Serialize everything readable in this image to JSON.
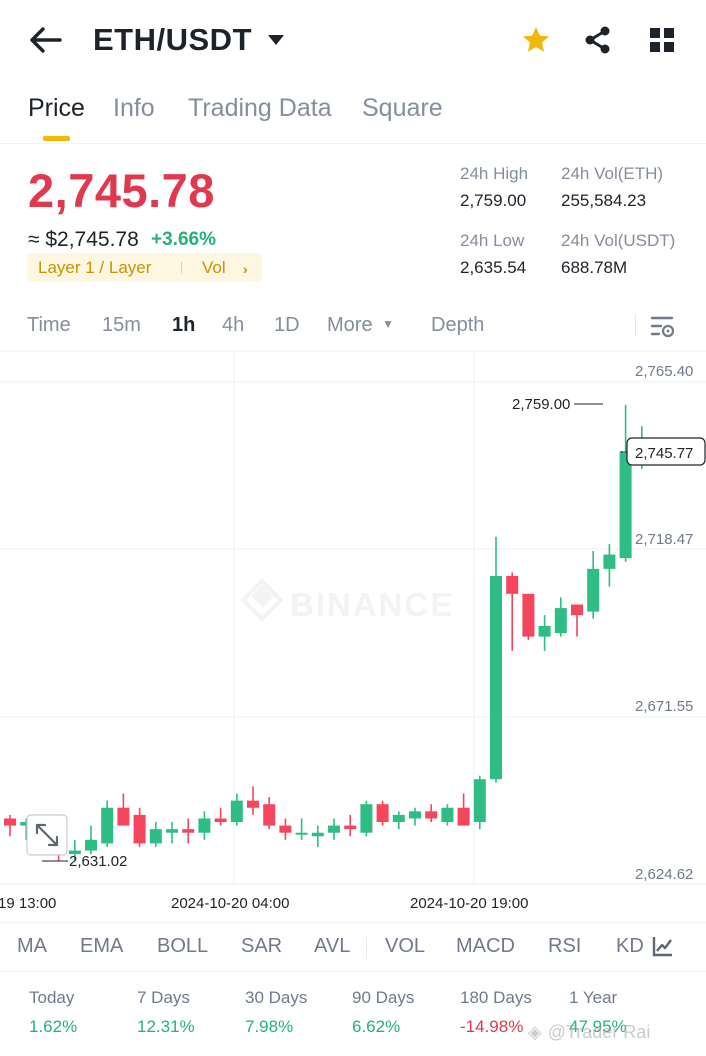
{
  "header": {
    "title": "ETH/USDT",
    "icons": [
      "back-arrow-icon",
      "dropdown-caret-icon",
      "star-icon",
      "share-icon",
      "grid-icon"
    ],
    "favorite_color": "#f0b90b"
  },
  "tabs": [
    "Price",
    "Info",
    "Trading Data",
    "Square"
  ],
  "price": {
    "last": "2,745.78",
    "usd": "≈ $2,745.78",
    "change": "+3.66%",
    "tag": "Layer 1 / Layer",
    "tag_vol": "Vol",
    "high_label": "24h High",
    "high": "2,759.00",
    "low_label": "24h Low",
    "low": "2,635.54",
    "vol_eth_label": "24h Vol(ETH)",
    "vol_eth": "255,584.23",
    "vol_usdt_label": "24h Vol(USDT)",
    "vol_usdt": "688.78M"
  },
  "intervals": [
    "Time",
    "15m",
    "1h",
    "4h",
    "1D",
    "More",
    "Depth"
  ],
  "chart_data": {
    "type": "candlestick",
    "interval": "1h",
    "y_ticks": [
      "2,765.40",
      "2,718.47",
      "2,671.55",
      "2,624.62"
    ],
    "ylim": [
      2624.62,
      2765.4
    ],
    "x_ticks": [
      "19 13:00",
      "2024-10-20 04:00",
      "2024-10-20 19:00"
    ],
    "max_label": "2,759.00",
    "min_label": "2,631.02",
    "last_label": "2,745.77",
    "watermark": "BINANCE",
    "up_color": "#2ebd85",
    "down_color": "#f6465d",
    "candles": [
      {
        "o": 2643,
        "h": 2644,
        "l": 2638,
        "c": 2641
      },
      {
        "o": 2641,
        "h": 2643,
        "l": 2637,
        "c": 2642
      },
      {
        "o": 2642,
        "h": 2642,
        "l": 2634,
        "c": 2636
      },
      {
        "o": 2636,
        "h": 2638,
        "l": 2631,
        "c": 2633
      },
      {
        "o": 2633,
        "h": 2637,
        "l": 2631,
        "c": 2634
      },
      {
        "o": 2634,
        "h": 2641,
        "l": 2633,
        "c": 2637
      },
      {
        "o": 2636,
        "h": 2648,
        "l": 2635,
        "c": 2646
      },
      {
        "o": 2646,
        "h": 2650,
        "l": 2641,
        "c": 2641
      },
      {
        "o": 2644,
        "h": 2646,
        "l": 2635,
        "c": 2636
      },
      {
        "o": 2636,
        "h": 2642,
        "l": 2635,
        "c": 2640
      },
      {
        "o": 2639,
        "h": 2642,
        "l": 2636,
        "c": 2640
      },
      {
        "o": 2640,
        "h": 2643,
        "l": 2636,
        "c": 2639
      },
      {
        "o": 2639,
        "h": 2645,
        "l": 2637,
        "c": 2643
      },
      {
        "o": 2643,
        "h": 2646,
        "l": 2641,
        "c": 2642
      },
      {
        "o": 2642,
        "h": 2650,
        "l": 2641,
        "c": 2648
      },
      {
        "o": 2648,
        "h": 2652,
        "l": 2644,
        "c": 2646
      },
      {
        "o": 2647,
        "h": 2649,
        "l": 2640,
        "c": 2641
      },
      {
        "o": 2641,
        "h": 2643,
        "l": 2637,
        "c": 2639
      },
      {
        "o": 2639,
        "h": 2643,
        "l": 2637,
        "c": 2639
      },
      {
        "o": 2638,
        "h": 2641,
        "l": 2635,
        "c": 2639
      },
      {
        "o": 2639,
        "h": 2643,
        "l": 2637,
        "c": 2641
      },
      {
        "o": 2641,
        "h": 2644,
        "l": 2638,
        "c": 2640
      },
      {
        "o": 2639,
        "h": 2648,
        "l": 2638,
        "c": 2647
      },
      {
        "o": 2647,
        "h": 2648,
        "l": 2641,
        "c": 2642
      },
      {
        "o": 2642,
        "h": 2645,
        "l": 2640,
        "c": 2644
      },
      {
        "o": 2643,
        "h": 2646,
        "l": 2641,
        "c": 2645
      },
      {
        "o": 2645,
        "h": 2647,
        "l": 2642,
        "c": 2643
      },
      {
        "o": 2642,
        "h": 2647,
        "l": 2641,
        "c": 2646
      },
      {
        "o": 2646,
        "h": 2650,
        "l": 2643,
        "c": 2641
      },
      {
        "o": 2642,
        "h": 2655,
        "l": 2640,
        "c": 2654
      },
      {
        "o": 2654,
        "h": 2722,
        "l": 2653,
        "c": 2711
      },
      {
        "o": 2711,
        "h": 2712,
        "l": 2690,
        "c": 2706
      },
      {
        "o": 2706,
        "h": 2706,
        "l": 2693,
        "c": 2694
      },
      {
        "o": 2694,
        "h": 2700,
        "l": 2690,
        "c": 2697
      },
      {
        "o": 2695,
        "h": 2705,
        "l": 2694,
        "c": 2702
      },
      {
        "o": 2703,
        "h": 2703,
        "l": 2694,
        "c": 2700
      },
      {
        "o": 2701,
        "h": 2718,
        "l": 2699,
        "c": 2713
      },
      {
        "o": 2713,
        "h": 2720,
        "l": 2708,
        "c": 2717
      },
      {
        "o": 2716,
        "h": 2759,
        "l": 2715,
        "c": 2746
      },
      {
        "o": 2745,
        "h": 2753,
        "l": 2741,
        "c": 2745.77
      }
    ]
  },
  "indicators": [
    "MA",
    "EMA",
    "BOLL",
    "SAR",
    "AVL",
    "VOL",
    "MACD",
    "RSI",
    "KD"
  ],
  "performance": [
    {
      "label": "Today",
      "value": "1.62%",
      "dir": "up"
    },
    {
      "label": "7 Days",
      "value": "12.31%",
      "dir": "up"
    },
    {
      "label": "30 Days",
      "value": "7.98%",
      "dir": "up"
    },
    {
      "label": "90 Days",
      "value": "6.62%",
      "dir": "up"
    },
    {
      "label": "180 Days",
      "value": "-14.98%",
      "dir": "down"
    },
    {
      "label": "1 Year",
      "value": "47.95%",
      "dir": "up"
    }
  ],
  "overlay": {
    "watermark": "@Trader Rai"
  }
}
